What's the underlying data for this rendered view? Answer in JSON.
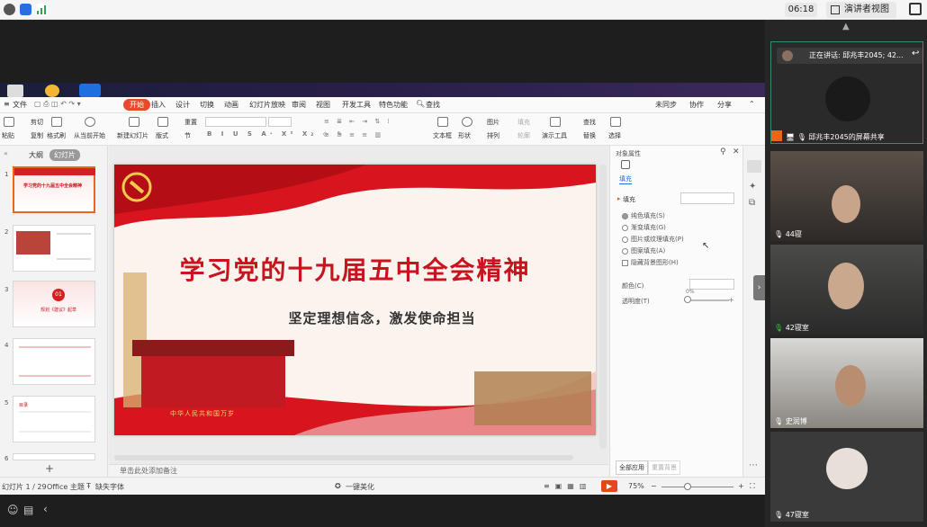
{
  "topbar": {
    "timer": "06:18",
    "view_button": "演讲者视图"
  },
  "menu": {
    "file": "文件",
    "items": [
      "开始",
      "插入",
      "设计",
      "切换",
      "动画",
      "幻灯片放映",
      "审阅",
      "视图",
      "开发工具",
      "特色功能"
    ],
    "search": "查找",
    "sync": "未同步",
    "collab": "协作",
    "share": "分享"
  },
  "ribbon": {
    "paste": "粘贴",
    "cut": "剪切",
    "copy": "复制",
    "format_painter": "格式刷",
    "play_from_current": "从当前开始",
    "new_slide": "新建幻灯片",
    "layout": "版式",
    "reset": "重置",
    "section": "节",
    "textbox": "文本框",
    "shape": "形状",
    "arrange": "排列",
    "picture": "图片",
    "fill": "填充",
    "outline": "轮廓",
    "presenter_tools": "演示工具",
    "find": "查找",
    "replace": "替换",
    "select": "选择"
  },
  "thumbs": {
    "tab_outline": "大纲",
    "tab_slides": "幻灯片",
    "numbers": [
      "1",
      "2",
      "3",
      "4",
      "5",
      "6"
    ],
    "slide1_title": "学习党的十九届五中全会精神",
    "slide3_badge": "01",
    "slide3_text": "规划《建议》起草",
    "slide5_text": "目录"
  },
  "slide": {
    "title": "学习党的十九届五中全会精神",
    "subtitle": "坚定理想信念，激发使命担当",
    "gate_text": "中华人民共和国万岁"
  },
  "notes": {
    "placeholder": "单击此处添加备注"
  },
  "props": {
    "header": "对象属性",
    "tab_fill": "填充",
    "section_fill": "填充",
    "options": [
      "纯色填充(S)",
      "渐变填充(G)",
      "图片或纹理填充(P)",
      "图案填充(A)"
    ],
    "hide_bg": "隐藏背景图形(H)",
    "color_label": "颜色(C)",
    "transparency_label": "透明度(T)",
    "transparency_value": "0%",
    "apply_all": "全部应用",
    "reset_bg": "重置背景"
  },
  "status": {
    "slide_info": "幻灯片 1 / 29",
    "theme": "Office 主题",
    "font_missing": "缺失字体",
    "beautify": "一键美化",
    "zoom": "75%"
  },
  "participants": {
    "speaking": "正在讲话: 邱兆丰2045; 42...",
    "screen_share": "邱兆丰2045的屏幕共享",
    "tiles": [
      "44寝",
      "42寝室",
      "史润博",
      "47寝室"
    ]
  }
}
